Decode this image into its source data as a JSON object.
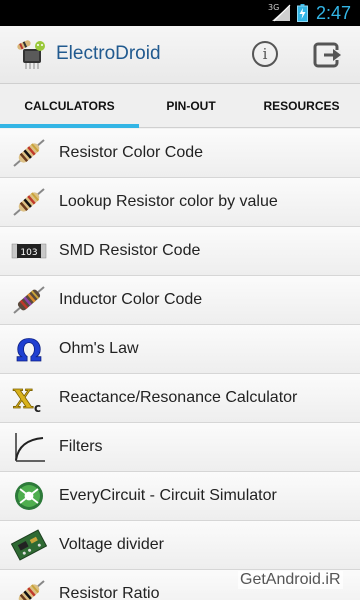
{
  "status_bar": {
    "network": "3G",
    "time": "2:47",
    "icons": [
      "signal-icon",
      "battery-charging-icon"
    ]
  },
  "app_bar": {
    "title": "ElectroDroid",
    "logo_icon": "electrodroid-logo-icon",
    "actions": [
      "info-icon",
      "exit-icon"
    ]
  },
  "tabs": [
    {
      "label": "CALCULATORS",
      "selected": true
    },
    {
      "label": "PIN-OUT",
      "selected": false
    },
    {
      "label": "RESOURCES",
      "selected": false
    }
  ],
  "list": [
    {
      "label": "Resistor Color Code",
      "icon": "resistor-icon"
    },
    {
      "label": "Lookup Resistor color by value",
      "icon": "resistor-icon"
    },
    {
      "label": "SMD Resistor Code",
      "icon": "smd-resistor-icon",
      "icon_text": "103"
    },
    {
      "label": "Inductor Color Code",
      "icon": "inductor-icon"
    },
    {
      "label": "Ohm's Law",
      "icon": "omega-icon",
      "icon_text": "Ω"
    },
    {
      "label": "Reactance/Resonance Calculator",
      "icon": "reactance-icon",
      "icon_text": "X",
      "icon_sub": "c"
    },
    {
      "label": "Filters",
      "icon": "filter-curve-icon"
    },
    {
      "label": "EveryCircuit - Circuit Simulator",
      "icon": "everycircuit-icon"
    },
    {
      "label": "Voltage divider",
      "icon": "circuit-board-icon"
    },
    {
      "label": "Resistor Ratio",
      "icon": "resistor-icon"
    }
  ],
  "watermark": "GetAndroid.iR",
  "colors": {
    "accent": "#33b5e5",
    "title": "#215a8f",
    "status_bar": "#000000"
  }
}
